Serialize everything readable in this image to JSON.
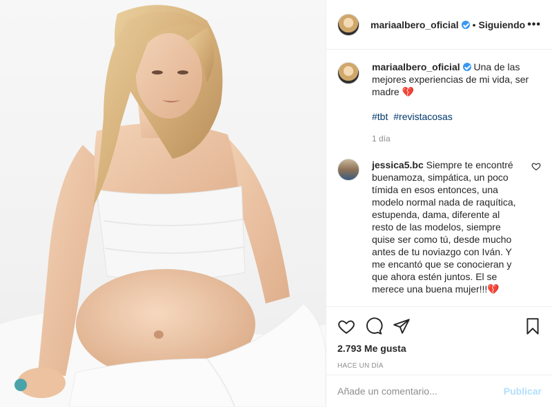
{
  "photo": {
    "alt": ""
  },
  "header": {
    "username": "mariaalbero_oficial",
    "separator": "•",
    "follow_status": "Siguiendo",
    "more": "•••"
  },
  "caption": {
    "username": "mariaalbero_oficial",
    "text": "Una de las mejores experiencias de mi vida, ser madre",
    "emoji": "💔",
    "hashtags": [
      "#tbt",
      "#revistacosas"
    ],
    "age": "1 día"
  },
  "comments": [
    {
      "username": "jessica5.bc",
      "text": "Siempre te encontré buenamoza, simpática, un poco tímida en esos entonces, una modelo normal nada de raquítica, estupenda, dama, diferente al resto de las modelos, siempre quise ser como tú, desde mucho antes de tu noviazgo con Iván. Y me encantó que se conocieran y que ahora estén juntos. El se merece una buena mujer!!!",
      "emoji": "💔"
    }
  ],
  "actions": {
    "likes": "2.793 Me gusta",
    "timestamp": "HACE UN DÍA"
  },
  "add_comment": {
    "placeholder": "Añade un comentario...",
    "publish": "Publicar"
  },
  "colors": {
    "verified": "#3897f0",
    "hashtag": "#00376b",
    "muted": "#8e8e8e",
    "publish_disabled": "#b2dffc",
    "heart_emoji": "#e0245e"
  }
}
